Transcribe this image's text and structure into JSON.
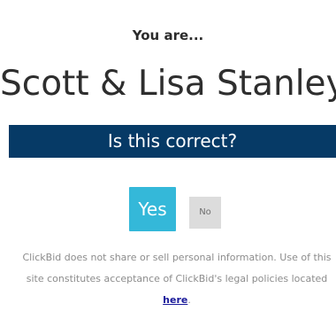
{
  "prompt": "You are...",
  "bidder_name": "Scott & Lisa Stanley",
  "banner": "Is this correct?",
  "buttons": {
    "yes": "Yes",
    "no": "No"
  },
  "notice": {
    "text": "ClickBid does not share or sell personal information. Use of this site constitutes acceptance of ClickBid's legal policies located ",
    "link": "here",
    "end": "."
  },
  "colors": {
    "banner_bg": "#063a66",
    "yes_bg": "#34b8d9",
    "no_bg": "#dcdcdc",
    "link": "#1a1a9a"
  }
}
